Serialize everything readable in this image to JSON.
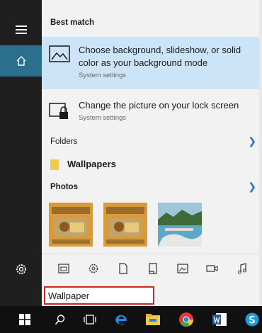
{
  "sections": {
    "best_match": "Best match",
    "folders": "Folders",
    "photos": "Photos"
  },
  "results": [
    {
      "title_line1": "Choose background, slideshow, or solid",
      "title_line2": "color as your background mode",
      "subtitle": "System settings",
      "icon": "picture-settings-icon"
    },
    {
      "title_line1": "Change the picture on your lock screen",
      "subtitle": "System settings",
      "icon": "lock-screen-icon"
    }
  ],
  "folder": {
    "name": "Wallpapers"
  },
  "search": {
    "value": "Wallpaper"
  },
  "filters": [
    "apps-filter",
    "settings-filter",
    "documents-filter",
    "folders-filter",
    "photos-filter",
    "videos-filter",
    "music-filter"
  ],
  "colors": {
    "accent": "#2b6f8f",
    "selected": "#cce4f7",
    "highlight_border": "#c62828"
  }
}
